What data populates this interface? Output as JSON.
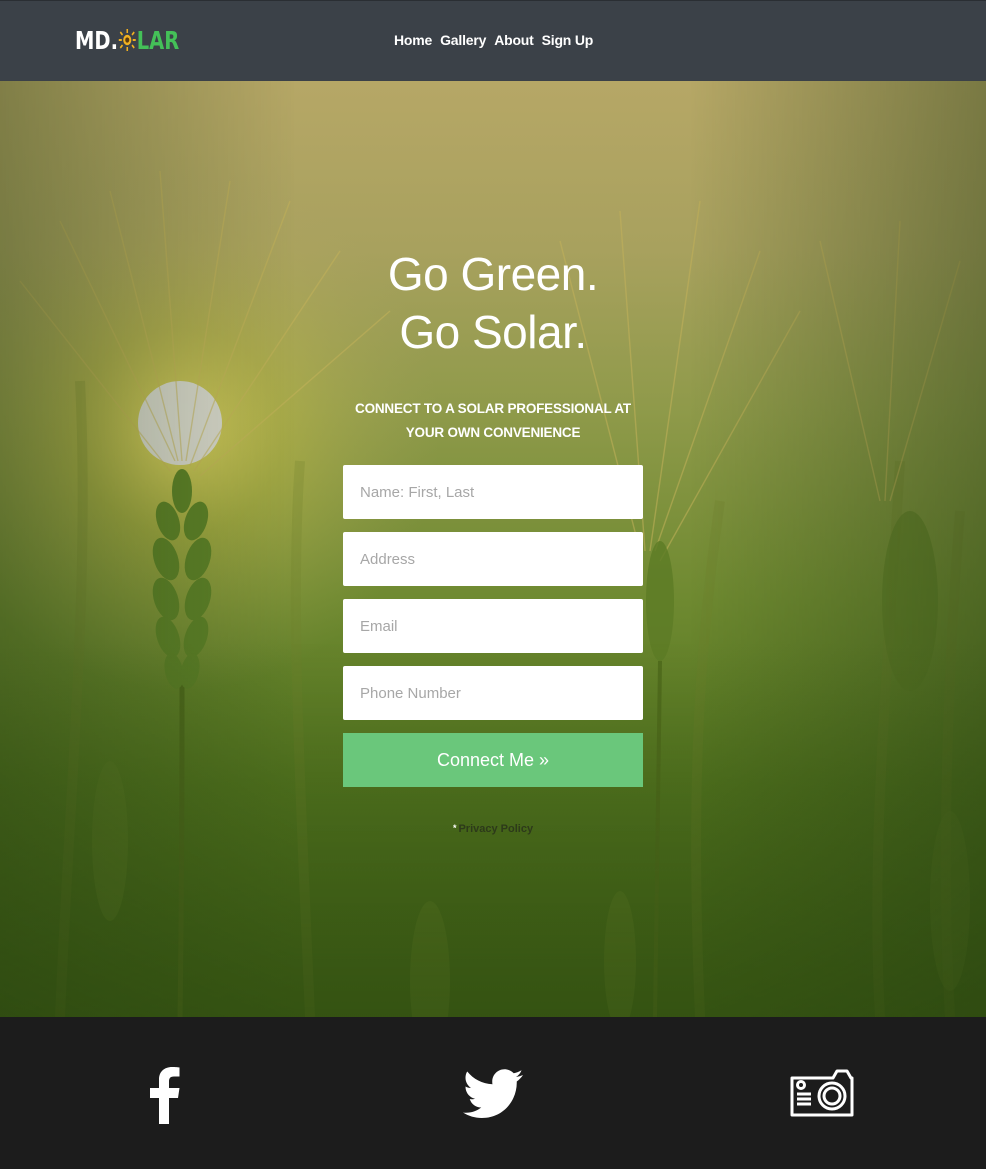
{
  "header": {
    "logo_prefix": "MD.",
    "logo_s": "S",
    "logo_suffix": "LAR",
    "nav": [
      "Home",
      "Gallery",
      "About",
      "Sign Up"
    ]
  },
  "hero": {
    "headline_line1": "Go Green.",
    "headline_line2": "Go Solar.",
    "subhead_line1": "CONNECT TO A SOLAR PROFESSIONAL AT",
    "subhead_line2": "YOUR OWN CONVENIENCE"
  },
  "form": {
    "name_placeholder": "Name: First, Last",
    "address_placeholder": "Address",
    "email_placeholder": "Email",
    "phone_placeholder": "Phone Number",
    "submit_label": "Connect Me »",
    "privacy_marker": "*",
    "privacy_label": "Privacy Policy"
  },
  "footer": {
    "icons": [
      "facebook-icon",
      "twitter-icon",
      "camera-icon"
    ]
  },
  "colors": {
    "header_bg": "#3b4148",
    "brand_green": "#44c058",
    "button_green": "#6ac77b",
    "footer_bg": "#1c1c1c"
  }
}
